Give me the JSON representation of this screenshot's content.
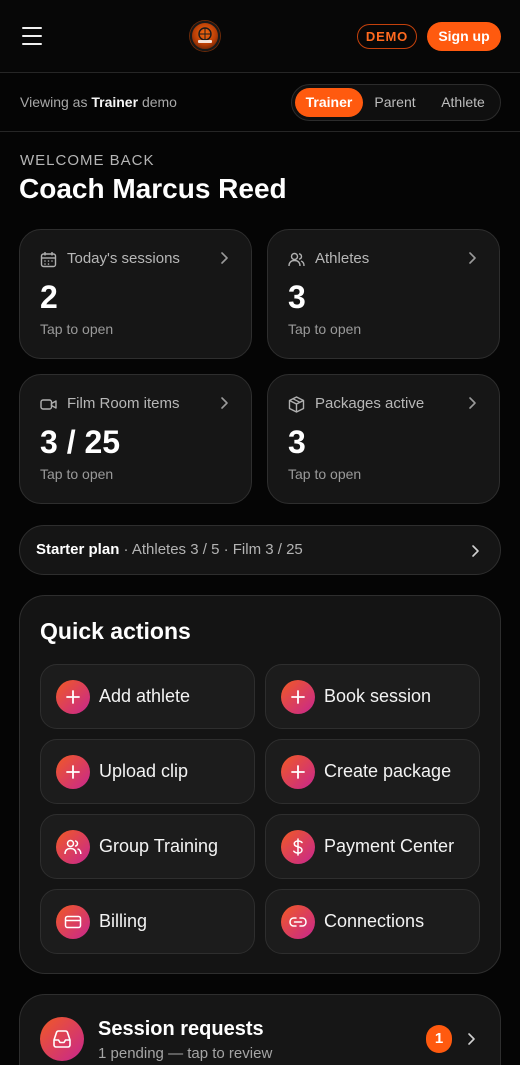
{
  "header": {
    "demo_badge": "DEMO",
    "signup_label": "Sign up"
  },
  "role_bar": {
    "viewing_prefix": "Viewing as",
    "viewing_role": "Trainer",
    "viewing_suffix": "demo",
    "options": [
      "Trainer",
      "Parent",
      "Athlete"
    ],
    "selected": "Trainer"
  },
  "welcome": {
    "subtitle": "WELCOME BACK",
    "name": "Coach Marcus Reed"
  },
  "stats": [
    {
      "label": "Today's sessions",
      "value": "2",
      "hint": "Tap to open",
      "icon": "calendar-icon"
    },
    {
      "label": "Athletes",
      "value": "3",
      "hint": "Tap to open",
      "icon": "users-icon"
    },
    {
      "label": "Film Room items",
      "value": "3 / 25",
      "hint": "Tap to open",
      "icon": "video-icon"
    },
    {
      "label": "Packages active",
      "value": "3",
      "hint": "Tap to open",
      "icon": "package-icon"
    }
  ],
  "plan": {
    "name": "Starter plan",
    "details": " · Athletes 3 / 5 · Film 3 / 25"
  },
  "quick_actions": {
    "title": "Quick actions",
    "items": [
      {
        "label": "Add athlete",
        "icon": "plus-icon"
      },
      {
        "label": "Book session",
        "icon": "plus-icon"
      },
      {
        "label": "Upload clip",
        "icon": "plus-icon"
      },
      {
        "label": "Create package",
        "icon": "plus-icon"
      },
      {
        "label": "Group Training",
        "icon": "group-icon"
      },
      {
        "label": "Payment Center",
        "icon": "dollar-icon"
      },
      {
        "label": "Billing",
        "icon": "credit-card-icon"
      },
      {
        "label": "Connections",
        "icon": "link-icon"
      }
    ]
  },
  "session_requests": {
    "title": "Session requests",
    "subtitle": "1 pending — tap to review",
    "count": "1",
    "icon": "inbox-icon"
  },
  "colors": {
    "accent": "#ff5a0f",
    "gradient_start": "#f15a24",
    "gradient_end": "#c7268f",
    "card_bg": "#161616"
  }
}
